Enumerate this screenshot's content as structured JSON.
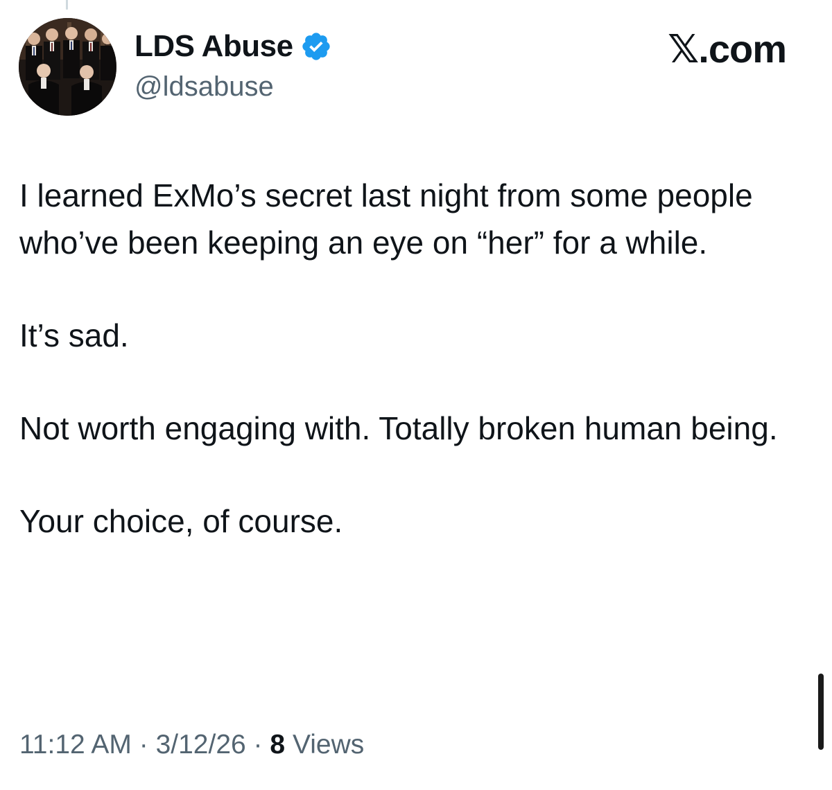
{
  "brand": {
    "label": "𝕏.com"
  },
  "author": {
    "display_name": "LDS Abuse",
    "handle": "@ldsabuse",
    "verified": true,
    "verified_color": "#1d9bf0",
    "avatar_icon": "group-photo-avatar"
  },
  "tweet": {
    "paragraphs": [
      "I learned ExMo’s secret last night from some people who’ve been keeping an eye on “her” for a while.",
      "It’s sad.",
      "Not worth engaging with. Totally broken human being.",
      "Your choice, of course."
    ]
  },
  "meta": {
    "time": "11:12 AM",
    "separator": "·",
    "date": "3/12/26",
    "views_count": "8",
    "views_label": "Views"
  },
  "colors": {
    "text": "#0f1419",
    "secondary": "#536471",
    "background": "#ffffff"
  }
}
